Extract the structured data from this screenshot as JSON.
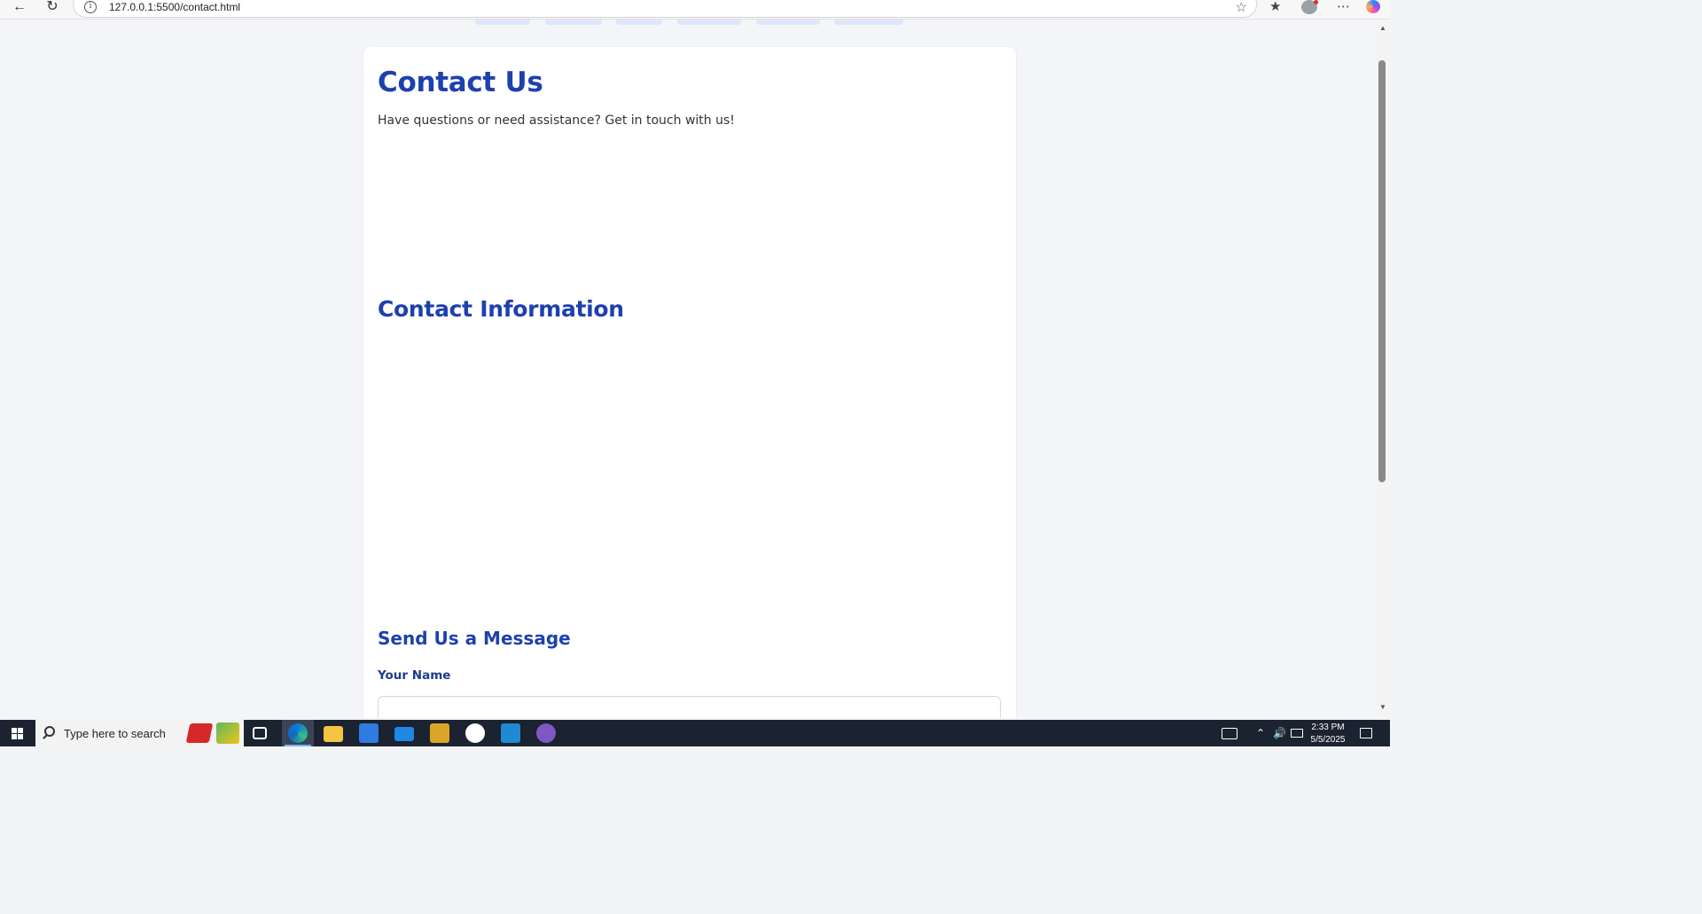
{
  "browser": {
    "url": "127.0.0.1:5500/contact.html",
    "back_icon": "back-arrow-icon",
    "reload_icon": "reload-icon"
  },
  "page": {
    "title": "Contact Us",
    "subtitle": "Have questions or need assistance? Get in touch with us!",
    "contact_info_heading": "Contact Information",
    "message_heading": "Send Us a Message",
    "name_label": "Your Name",
    "name_value": ""
  },
  "taskbar": {
    "search_placeholder": "Type here to search",
    "time": "2:33 PM",
    "date": "5/5/2025"
  },
  "colors": {
    "heading": "#1e40af",
    "background": "#f3f5f9",
    "taskbar": "#1b2230"
  }
}
